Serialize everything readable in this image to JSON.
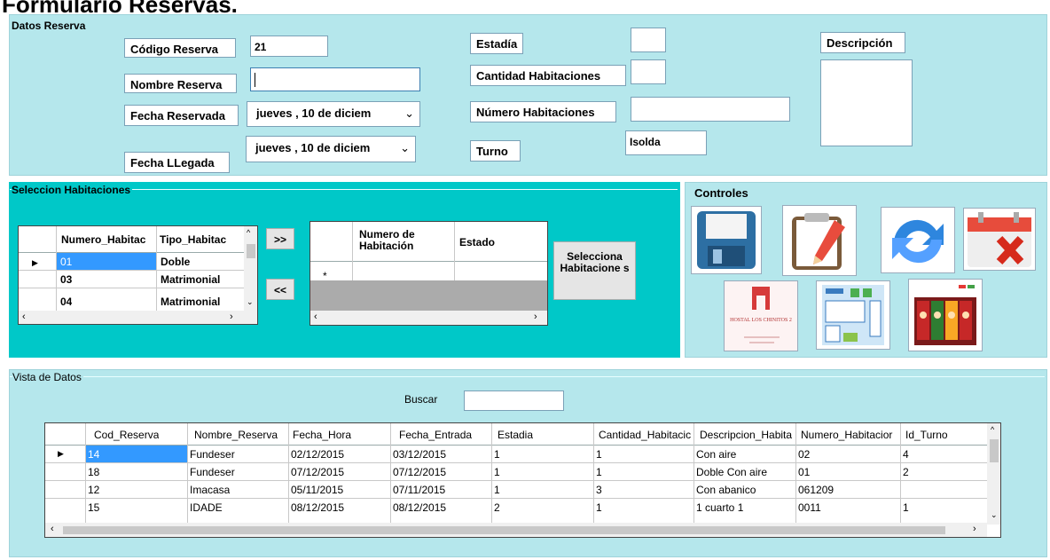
{
  "title": "Formulario Reservas.",
  "datos_reserva": {
    "group_title": "Datos Reserva",
    "codigo_label": "Código Reserva",
    "codigo_value": "21",
    "nombre_label": "Nombre Reserva",
    "nombre_value": "",
    "fecha_reservada_label": "Fecha Reservada",
    "fecha_reservada_value": "jueves   , 10 de  diciem",
    "fecha_llegada_label": "Fecha LLegada",
    "fecha_llegada_value": "jueves   , 10 de  diciem",
    "estadia_label": "Estadía",
    "cantidad_label": "Cantidad  Habitaciones",
    "numero_label": "Número Habitaciones",
    "turno_label": "Turno",
    "turno_value": "Isolda",
    "descripcion_label": "Descripción"
  },
  "seleccion": {
    "group_title": "Seleccion Habitaciones",
    "left_grid": {
      "columns": [
        "Numero_Habitac",
        "Tipo_Habitac"
      ],
      "rows": [
        [
          "01",
          "Doble"
        ],
        [
          "03",
          "Matrimonial"
        ],
        [
          "04",
          "Matrimonial"
        ]
      ]
    },
    "move_right": ">>",
    "move_left": "<<",
    "right_grid": {
      "columns": [
        "Numero de Habitación",
        "Estado"
      ],
      "new_row_marker": "*"
    },
    "select_button": "Selecciona Habitacione s"
  },
  "controles": {
    "group_title": "Controles",
    "icons": [
      "save-icon",
      "edit-icon",
      "refresh-icon",
      "delete-calendar-icon",
      "hostal-logo-icon",
      "report-icon",
      "gallery-icon"
    ],
    "logo_text": "HOSTAL LOS CHINITOS 2"
  },
  "vista": {
    "group_title": "Vista de Datos",
    "buscar_label": "Buscar",
    "buscar_value": "",
    "columns": [
      "Cod_Reserva",
      "Nombre_Reserva",
      "Fecha_Hora",
      "Fecha_Entrada",
      "Estadia",
      "Cantidad_Habitacic",
      "Descripcion_Habita",
      "Numero_Habitacior",
      "Id_Turno"
    ],
    "rows": [
      [
        "14",
        "Fundeser",
        "02/12/2015",
        "03/12/2015",
        "1",
        "1",
        "Con aire",
        "02",
        "4"
      ],
      [
        "18",
        "Fundeser",
        "07/12/2015",
        "07/12/2015",
        "1",
        "1",
        "Doble Con aire",
        "01",
        "2"
      ],
      [
        "12",
        "Imacasa",
        "05/11/2015",
        "07/11/2015",
        "1",
        "3",
        "Con abanico",
        "061209",
        ""
      ],
      [
        "15",
        "IDADE",
        "08/12/2015",
        "08/12/2015",
        "2",
        "1",
        "1 cuarto 1",
        "0011",
        "1"
      ]
    ]
  },
  "colors": {
    "panel": "#b5e7ec",
    "teal": "#00c8c8",
    "selection": "#3399ff"
  }
}
